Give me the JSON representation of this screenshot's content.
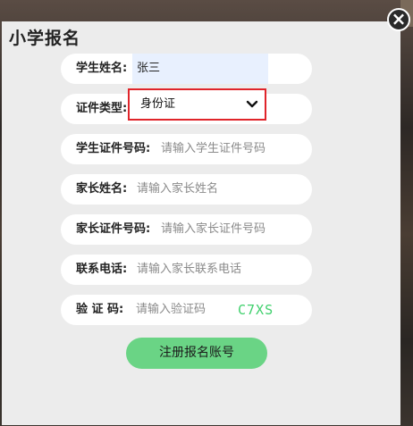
{
  "dialog": {
    "title": "小学报名",
    "close_icon": "×"
  },
  "form": {
    "student_name": {
      "label": "学生姓名:",
      "value": "张三"
    },
    "id_type": {
      "label": "证件类型:",
      "selected": "身份证"
    },
    "student_id_number": {
      "label": "学生证件号码:",
      "placeholder": "请输入学生证件号码"
    },
    "parent_name": {
      "label": "家长姓名:",
      "placeholder": "请输入家长姓名"
    },
    "parent_id_number": {
      "label": "家长证件号码:",
      "placeholder": "请输入家长证件号码"
    },
    "contact_phone": {
      "label": "联系电话:",
      "placeholder": "请输入家长联系电话"
    },
    "captcha": {
      "label": "验 证 码:",
      "placeholder": "请输入验证码",
      "code": "C7XS"
    }
  },
  "submit_label": "注册报名账号",
  "colors": {
    "highlight_border": "#e0242a",
    "captcha_text": "#3fd06c",
    "submit_bg": "#6ad485"
  }
}
